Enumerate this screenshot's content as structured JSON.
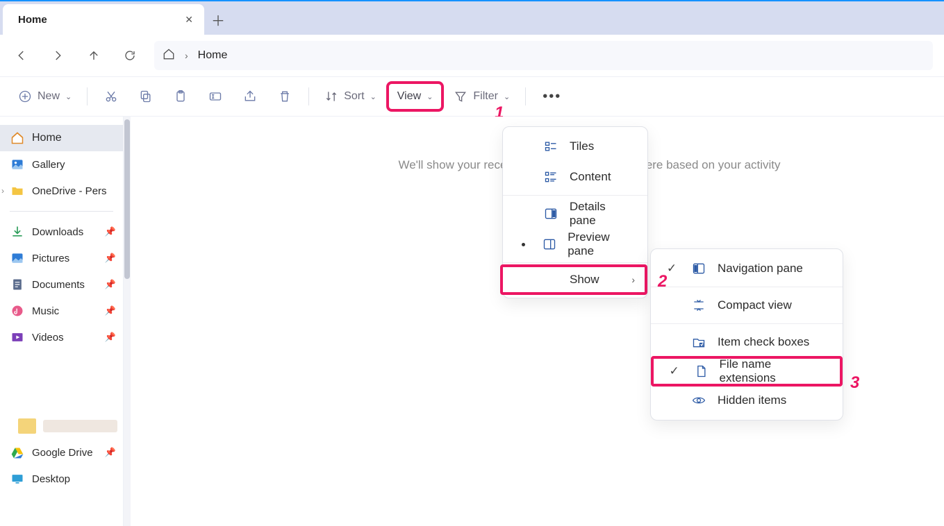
{
  "tabs": {
    "active_title": "Home"
  },
  "breadcrumb": {
    "current": "Home"
  },
  "toolbar": {
    "new_label": "New",
    "sort_label": "Sort",
    "view_label": "View",
    "filter_label": "Filter"
  },
  "annotations": {
    "one": "1",
    "two": "2",
    "three": "3"
  },
  "sidebar": {
    "main": [
      {
        "label": "Home"
      },
      {
        "label": "Gallery"
      },
      {
        "label": "OneDrive - Pers"
      }
    ],
    "pinned": [
      {
        "label": "Downloads"
      },
      {
        "label": "Pictures"
      },
      {
        "label": "Documents"
      },
      {
        "label": "Music"
      },
      {
        "label": "Videos"
      }
    ],
    "extra": [
      {
        "label": "Google Drive"
      },
      {
        "label": "Desktop"
      }
    ]
  },
  "content": {
    "empty_msg": "We'll show your recent files and other content here based on your activity"
  },
  "view_menu": {
    "tiles": "Tiles",
    "content": "Content",
    "details_pane": "Details pane",
    "preview_pane": "Preview pane",
    "show": "Show"
  },
  "show_submenu": {
    "nav_pane": "Navigation pane",
    "compact": "Compact view",
    "checkboxes": "Item check boxes",
    "extensions": "File name extensions",
    "hidden": "Hidden items"
  }
}
